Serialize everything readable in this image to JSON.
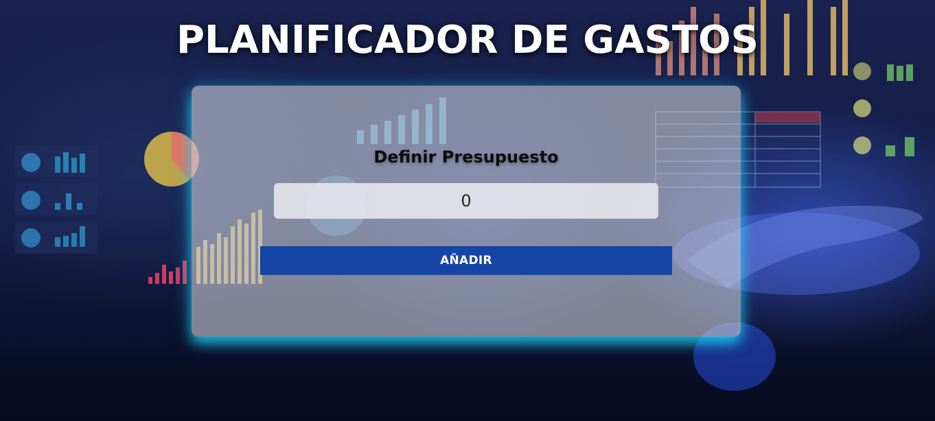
{
  "header": {
    "title": "PLANIFICADOR DE GASTOS"
  },
  "budget_form": {
    "heading": "Definir Presupuesto",
    "amount_value": "0",
    "add_button_label": "AÑADIR"
  },
  "colors": {
    "button_bg": "#1546a6",
    "card_glow": "#1edcff",
    "title_text": "#ffffff"
  }
}
